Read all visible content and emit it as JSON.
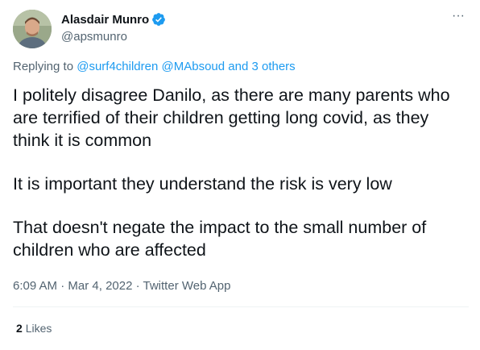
{
  "author": {
    "display_name": "Alasdair Munro",
    "handle": "@apsmunro",
    "verified": true
  },
  "more_label": "···",
  "replying": {
    "prefix": "Replying to",
    "mention_1": "@surf4children",
    "mention_2": "@MAbsoud",
    "others": "and 3 others"
  },
  "tweet": {
    "paragraph_1": "I politely disagree Danilo, as there are many parents who are terrified of their children getting long covid, as they think it is common",
    "paragraph_2": "It is important they understand the risk is very low",
    "paragraph_3": "That doesn't negate the impact to the small number of children who are affected"
  },
  "meta": {
    "time": "6:09 AM",
    "separator": "·",
    "date": "Mar 4, 2022",
    "source": "Twitter Web App"
  },
  "engagement": {
    "likes_count": "2",
    "likes_label": "Likes"
  },
  "colors": {
    "accent": "#1d9bf0",
    "secondary_text": "#536471",
    "primary_text": "#0f1419",
    "divider": "#eff3f4"
  }
}
